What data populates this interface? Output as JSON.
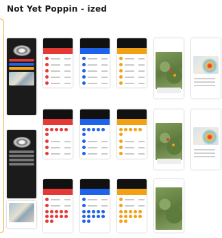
{
  "title": "Not Yet Poppin - ized",
  "colors": {
    "red": "#e53935",
    "blue": "#1e63e9",
    "orange": "#f3a114",
    "frame": "#e7b53c"
  }
}
